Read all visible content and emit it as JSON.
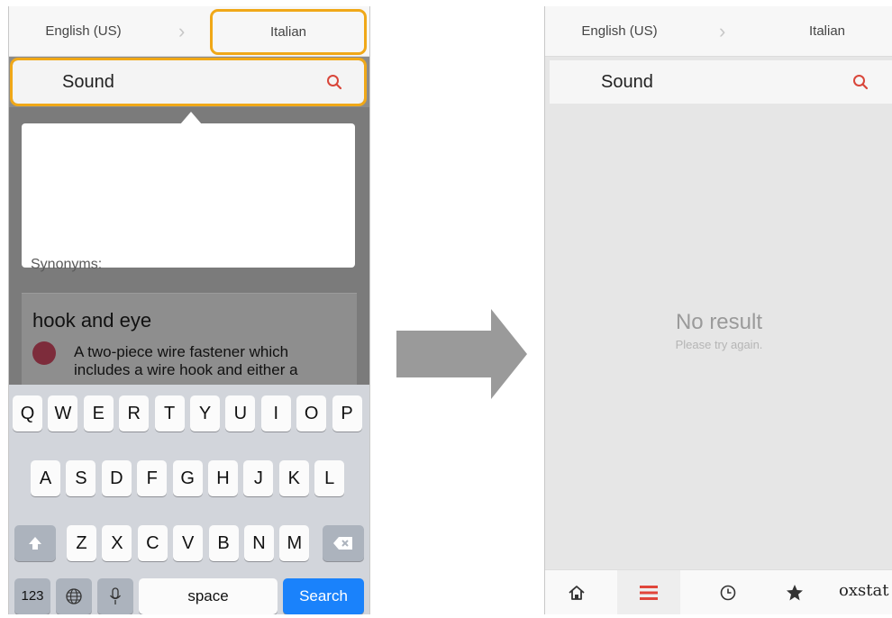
{
  "left": {
    "source_language": "English (US)",
    "target_language": "Italian",
    "search_query": "Sound",
    "synonyms_label": "Synonyms:",
    "entry_title": "hook and eye",
    "entry_definition": "A two-piece wire fastener which includes a wire hook and either a",
    "keyboard": {
      "row1": [
        "Q",
        "W",
        "E",
        "R",
        "T",
        "Y",
        "U",
        "I",
        "O",
        "P"
      ],
      "row2": [
        "A",
        "S",
        "D",
        "F",
        "G",
        "H",
        "J",
        "K",
        "L"
      ],
      "row3": [
        "Z",
        "X",
        "C",
        "V",
        "B",
        "N",
        "M"
      ],
      "numbers_key": "123",
      "space_key": "space",
      "search_key": "Search"
    }
  },
  "right": {
    "source_language": "English (US)",
    "target_language": "Italian",
    "search_query": "Sound",
    "empty_title": "No result",
    "empty_subtitle": "Please try again.",
    "brand": "oxstat"
  },
  "colors": {
    "highlight": "#f0a818",
    "search_icon": "#d9463a",
    "menu_active": "#e0453a",
    "search_button": "#1a82fb"
  },
  "icons": [
    "search-icon",
    "home-icon",
    "menu-icon",
    "clock-icon",
    "star-icon",
    "shift-icon",
    "backspace-icon",
    "globe-icon",
    "microphone-icon"
  ]
}
